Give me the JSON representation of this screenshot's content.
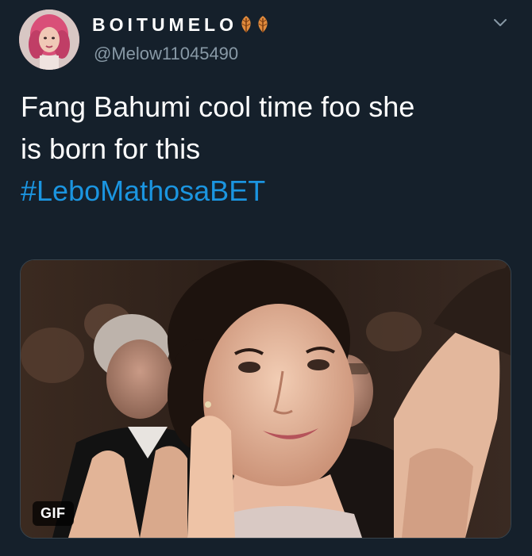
{
  "tweet": {
    "display_name": "BOITUMELO",
    "handle": "@Melow11045490",
    "text_line1": "Fang Bahumi cool time foo she",
    "text_line2": "is born for this",
    "hashtag": "#LeboMathosaBET",
    "media": {
      "badge": "GIF",
      "description_icon": "clapping-woman-gif"
    }
  },
  "icons": {
    "name_emoji": "leaf-icon",
    "menu": "chevron-down-icon"
  },
  "colors": {
    "background": "#15202b",
    "text": "#ffffff",
    "secondary_text": "#8899a6",
    "link": "#1b95e0",
    "leaf": "#e08a3c"
  }
}
